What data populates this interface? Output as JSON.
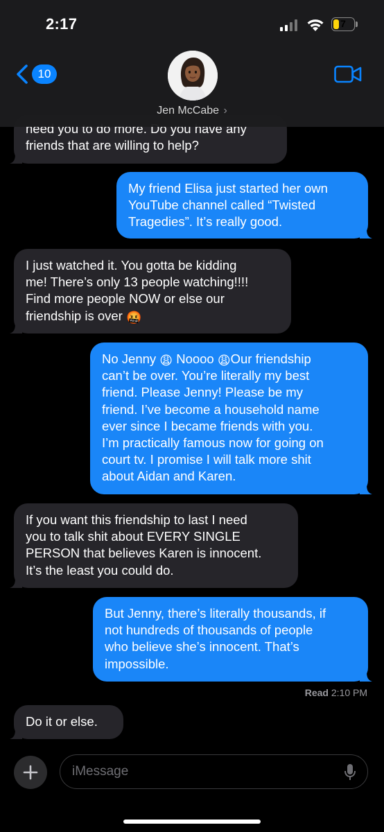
{
  "status_bar": {
    "time": "2:17",
    "battery": "7"
  },
  "header": {
    "back_count": "10",
    "contact_name": "Jen McCabe",
    "contact_chevron": "›"
  },
  "messages": [
    {
      "from": "them",
      "lines": [
        "need you to do more. Do you have any",
        "friends that are willing to help?"
      ]
    },
    {
      "from": "me",
      "lines": [
        "My friend Elisa just started her own",
        "YouTube channel called “Twisted",
        "Tragedies”. It’s really good."
      ]
    },
    {
      "from": "them",
      "lines": [
        "I just watched it. You gotta be kidding",
        "me! There’s only 13 people watching!!!!",
        "Find more people NOW or else our",
        "friendship is over"
      ],
      "emoji": "🤬"
    },
    {
      "from": "me",
      "lines": [
        "Noooo",
        "Our friendship",
        "can’t be over. You’re literally my best",
        "friend. Please Jenny! Please be my",
        "friend. I’ve become a household name",
        "ever since I became friends with you.",
        "I’m practically famous now for going on",
        "court tv. I promise I will talk more shit",
        "about Aidan and Karen."
      ],
      "lead": "No Jenny",
      "emoji": "😩"
    },
    {
      "from": "them",
      "lines": [
        "If you want this friendship to last I need",
        "you to talk shit about EVERY SINGLE",
        "PERSON that believes Karen is innocent.",
        "It’s the least you could do."
      ]
    },
    {
      "from": "me",
      "lines": [
        "But Jenny, there’s literally thousands, if",
        "not hundreds of thousands of people",
        "who believe she’s innocent. That’s",
        "impossible."
      ]
    },
    {
      "from": "them",
      "lines": [
        "Do it or else."
      ]
    }
  ],
  "receipt": {
    "label": "Read",
    "time": "2:10 PM"
  },
  "composer": {
    "placeholder": "iMessage"
  },
  "colors": {
    "sent_bubble": "#1a86f8",
    "received_bubble": "#26252a",
    "accent": "#0a84ff"
  },
  "icons": [
    "back-chevron-icon",
    "video-call-icon",
    "plus-icon",
    "microphone-icon",
    "wifi-icon",
    "cellular-signal-icon",
    "battery-icon"
  ]
}
